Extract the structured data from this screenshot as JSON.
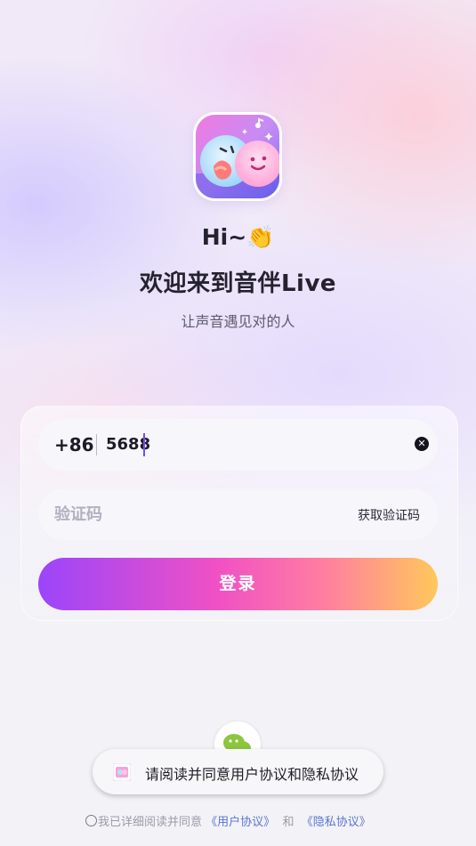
{
  "colors": {
    "accent": "#7a4cf2",
    "button_gradient": [
      "#9b45fb",
      "#f051c4",
      "#ff7fa0",
      "#ffc85b"
    ],
    "link": "#5a74d6",
    "wechat": "#8cc63f"
  },
  "header": {
    "greeting": "Hi~",
    "greeting_emoji": "👏",
    "welcome": "欢迎来到音伴Live",
    "tagline": "让声音遇见对的人"
  },
  "form": {
    "country_code": "+86",
    "phone_value": "5688",
    "code_placeholder": "验证码",
    "get_code_label": "获取验证码",
    "login_label": "登录"
  },
  "toast": {
    "text": "请阅读并同意用户协议和隐私协议"
  },
  "agreement": {
    "prefix": "我已详细阅读并同意",
    "user_link": "《用户协议》",
    "and": "和",
    "privacy_link": "《隐私协议》"
  },
  "icons": {
    "logo": "app-logo-icon",
    "clear": "clear-icon",
    "wechat": "wechat-icon",
    "toast": "app-mini-icon"
  }
}
